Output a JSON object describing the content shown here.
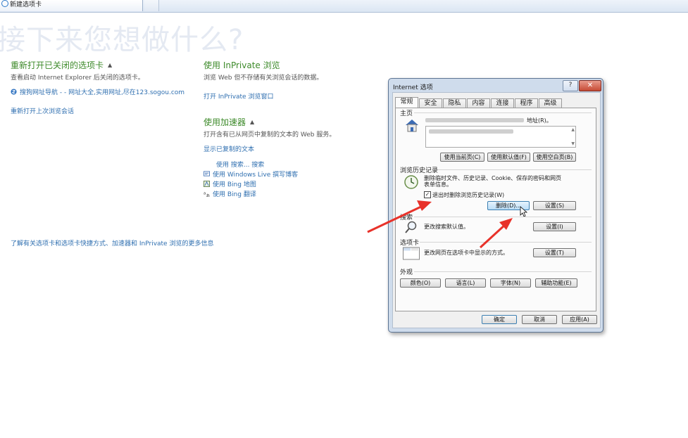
{
  "tab": {
    "label": "新建选项卡"
  },
  "heading": "接下来您想做什么?",
  "reopen": {
    "title": "重新打开已关闭的选项卡",
    "desc": "查看启动 Internet Explorer 后关闭的选项卡。",
    "item": "搜狗网址导航 - - 网址大全,实用网址,尽在123.sogou.com",
    "session": "重新打开上次浏览会话"
  },
  "inprivate": {
    "title": "使用 InPrivate 浏览",
    "desc": "浏览 Web 但不存储有关浏览会话的数据。",
    "open": "打开 InPrivate 浏览窗口"
  },
  "accel": {
    "title": "使用加速器",
    "desc": "打开含有已从网页中复制的文本的 Web 服务。",
    "show_copied": "显示已复制的文本",
    "items": [
      "使用 搜索... 搜索",
      "使用 Windows Live 撰写博客",
      "使用 Bing 地图",
      "使用 Bing 翻译"
    ]
  },
  "footer_link": "了解有关选项卡和选项卡快捷方式、加速器和 InPrivate 浏览的更多信息",
  "dialog": {
    "title": "Internet 选项",
    "help": "?",
    "close": "✕",
    "tabs": [
      "常规",
      "安全",
      "隐私",
      "内容",
      "连接",
      "程序",
      "高级"
    ],
    "homepage": {
      "group": "主页",
      "desc_tail": "地址(R)。",
      "buttons": [
        "使用当前页(C)",
        "使用默认值(F)",
        "使用空白页(B)"
      ]
    },
    "history": {
      "group": "浏览历史记录",
      "desc_line1": "删除临时文件、历史记录、Cookie、保存的密码和网页",
      "desc_line2": "表单信息。",
      "checkbox": "退出时删除浏览历史记录(W)",
      "checked": true,
      "delete_btn": "删除(D)...",
      "settings_btn": "设置(S)"
    },
    "search": {
      "group": "搜索",
      "desc": "更改搜索默认值。",
      "settings_btn": "设置(I)"
    },
    "tabsec": {
      "group": "选项卡",
      "desc": "更改网页在选项卡中显示的方式。",
      "settings_btn": "设置(T)"
    },
    "appearance": {
      "group": "外观",
      "buttons": [
        "颜色(O)",
        "语言(L)",
        "字体(N)",
        "辅助功能(E)"
      ]
    },
    "footer": {
      "ok": "确定",
      "cancel": "取消",
      "apply": "应用(A)"
    }
  },
  "colors": {
    "section_title": "#3d8a2a",
    "link": "#2f6fb0",
    "arrow": "#e8322a"
  }
}
